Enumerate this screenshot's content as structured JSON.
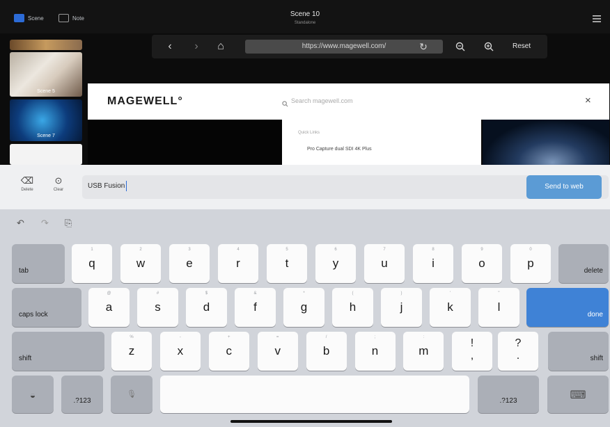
{
  "app": {
    "tabs": [
      {
        "label": "Scene",
        "icon": "video-icon"
      },
      {
        "label": "Note",
        "icon": "note-icon"
      }
    ],
    "scene_title": "Scene 10",
    "scene_subtitle": "Standalone",
    "menu_icon": "hamburger-icon"
  },
  "browser": {
    "url": "https://www.magewell.com/",
    "reset_label": "Reset",
    "back_icon": "‹",
    "forward_icon": "›",
    "home_icon": "⌂",
    "reload_icon": "↻",
    "zoom_out_icon": "−",
    "zoom_in_icon": "+"
  },
  "scenes": [
    {
      "label": "Scene 5"
    },
    {
      "label": "Scene 7"
    },
    {
      "label": ""
    }
  ],
  "webpage": {
    "logo": "MAGEWELL°",
    "search_placeholder": "Search magewell.com",
    "close": "×",
    "quick_links_title": "Quick Links",
    "quick_link_item": "Pro Capture dual SDI 4K Plus"
  },
  "input_toolbar": {
    "delete_label": "Delete",
    "clear_label": "Clear",
    "text_value": "USB Fusion",
    "send_label": "Send to web"
  },
  "keyboard": {
    "shortcuts": [
      "↶",
      "↷",
      "⎘"
    ],
    "row1": [
      {
        "hint": "1",
        "key": "q"
      },
      {
        "hint": "2",
        "key": "w"
      },
      {
        "hint": "3",
        "key": "e"
      },
      {
        "hint": "4",
        "key": "r"
      },
      {
        "hint": "5",
        "key": "t"
      },
      {
        "hint": "6",
        "key": "y"
      },
      {
        "hint": "7",
        "key": "u"
      },
      {
        "hint": "8",
        "key": "i"
      },
      {
        "hint": "9",
        "key": "o"
      },
      {
        "hint": "0",
        "key": "p"
      }
    ],
    "row2": [
      {
        "hint": "@",
        "key": "a"
      },
      {
        "hint": "#",
        "key": "s"
      },
      {
        "hint": "$",
        "key": "d"
      },
      {
        "hint": "&",
        "key": "f"
      },
      {
        "hint": "*",
        "key": "g"
      },
      {
        "hint": "(",
        "key": "h"
      },
      {
        "hint": ")",
        "key": "j"
      },
      {
        "hint": "'",
        "key": "k"
      },
      {
        "hint": "\"",
        "key": "l"
      }
    ],
    "row3": [
      {
        "hint": "%",
        "key": "z"
      },
      {
        "hint": "-",
        "key": "x"
      },
      {
        "hint": "+",
        "key": "c"
      },
      {
        "hint": "=",
        "key": "v"
      },
      {
        "hint": "/",
        "key": "b"
      },
      {
        "hint": ";",
        "key": "n"
      },
      {
        "hint": ":",
        "key": "m"
      }
    ],
    "tab": "tab",
    "delete": "delete",
    "caps_lock": "caps lock",
    "done": "done",
    "shift_left": "shift",
    "shift_right": "shift",
    "exclaim_top": "!",
    "exclaim_bottom": ",",
    "question_top": "?",
    "question_bottom": ".",
    "numbers_left": ".?123",
    "numbers_right": ".?123",
    "globe_icon": "◒",
    "mic_icon": "🎙",
    "hide_keyboard_icon": "⌨"
  },
  "colors": {
    "accent_blue": "#3f82d6",
    "send_blue": "#5b9bd5",
    "keyboard_bg": "#d1d4da"
  }
}
